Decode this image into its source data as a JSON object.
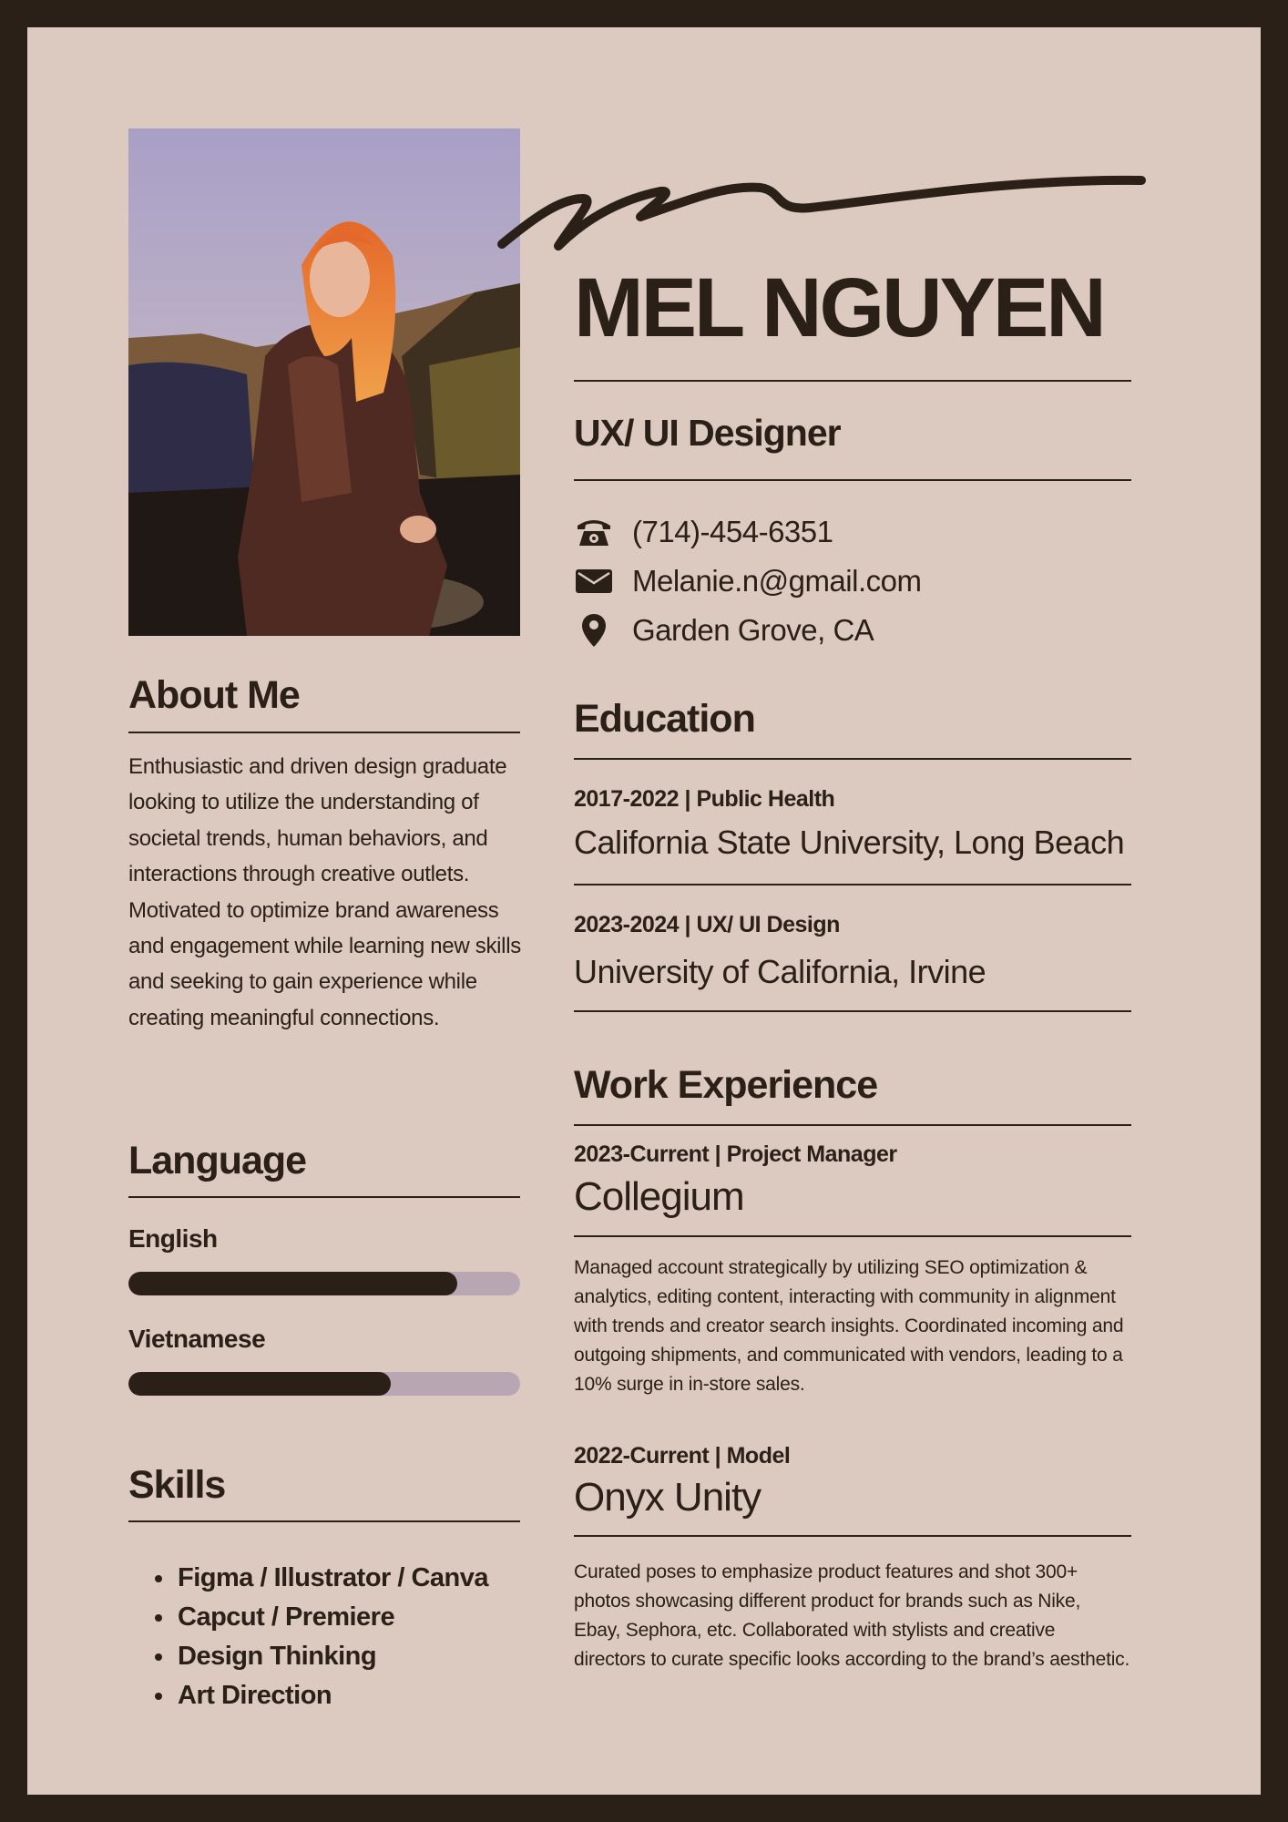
{
  "profile": {
    "name": "MEL NGUYEN",
    "title": "UX/ UI Designer",
    "photo_icon": "portrait-photo"
  },
  "contact": {
    "phone": "(714)-454-6351",
    "email": "Melanie.n@gmail.com",
    "location": "Garden Grove, CA"
  },
  "about": {
    "heading": "About Me",
    "text": "Enthusiastic and driven design graduate looking to utilize the understanding of societal trends, human behaviors, and interactions through creative outlets. Motivated to optimize brand awareness and engagement while learning new skills and seeking to gain experience while creating meaningful connections."
  },
  "language": {
    "heading": "Language",
    "items": [
      {
        "name": "English",
        "level": 0.84
      },
      {
        "name": "Vietnamese",
        "level": 0.67
      }
    ]
  },
  "skills": {
    "heading": "Skills",
    "items": [
      "Figma / Illustrator / Canva",
      "Capcut / Premiere",
      "Design Thinking",
      "Art Direction"
    ]
  },
  "education": {
    "heading": "Education",
    "items": [
      {
        "meta": "2017-2022 | Public Health",
        "school": "California State University, Long Beach"
      },
      {
        "meta": "2023-2024 | UX/ UI Design",
        "school": "University of California, Irvine"
      }
    ]
  },
  "work": {
    "heading": "Work Experience",
    "items": [
      {
        "meta": "2023-Current | Project Manager",
        "company": "Collegium",
        "description": "Managed account strategically by utilizing SEO optimization & analytics, editing content, interacting with community in alignment with trends and creator search insights. Coordinated incoming and outgoing shipments, and communicated with vendors, leading to a 10% surge in in-store sales."
      },
      {
        "meta": "2022-Current | Model",
        "company": "Onyx Unity",
        "description": "Curated poses to emphasize product features and shot 300+ photos showcasing different product for brands such as Nike, Ebay, Sephora, etc. Collaborated with stylists and creative directors to curate specific looks according to the brand’s aesthetic."
      }
    ]
  },
  "colors": {
    "frame": "#2b2018",
    "paper": "#dccac1",
    "ink": "#2b2018",
    "bar_track": "#b8a7b3"
  },
  "icons": [
    "phone-icon",
    "mail-icon",
    "location-pin-icon",
    "signature-flourish"
  ]
}
